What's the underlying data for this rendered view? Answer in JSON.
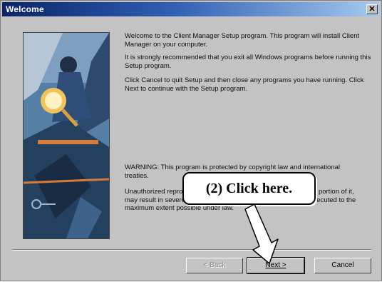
{
  "window": {
    "title": "Welcome",
    "close_glyph": "✕"
  },
  "content": {
    "p1": "Welcome to the Client Manager Setup program.  This program will install Client Manager on your computer.",
    "p2": "It is strongly recommended that you exit all Windows programs before running this Setup program.",
    "p3": "Click Cancel to quit Setup and then close any programs you have running.  Click Next to continue with the Setup program.",
    "p4": "WARNING: This program is protected by copyright law and international treaties.",
    "p5": "Unauthorized reproduction or distribution of this program, or any portion of it, may result in severe civil and criminal penalties, and will be prosecuted to the maximum extent possible under law."
  },
  "buttons": {
    "back": "< Back",
    "next": "Next >",
    "cancel": "Cancel"
  },
  "callout": {
    "text": "(2)  Click here."
  },
  "icons": {
    "close": "close-icon",
    "art": "setup-wizard-illustration"
  }
}
